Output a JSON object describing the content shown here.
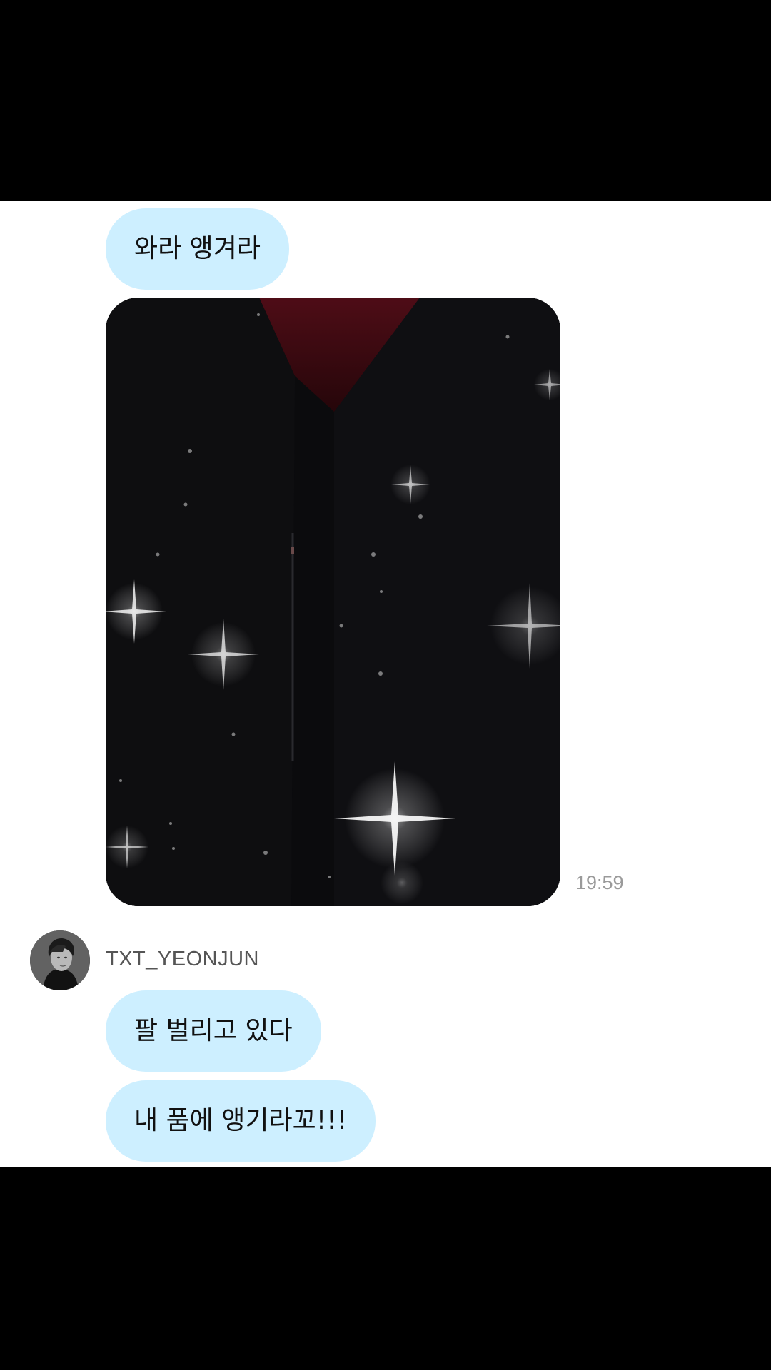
{
  "messages": [
    {
      "text": "와라 앵겨라"
    }
  ],
  "media_message": {
    "timestamp": "19:59"
  },
  "incoming": {
    "sender_name": "TXT_YEONJUN",
    "messages": [
      {
        "text": "팔 벌리고 있다"
      },
      {
        "text": "내 품에 앵기라꼬!!!"
      }
    ]
  },
  "colors": {
    "bubble": "#cdefff",
    "chat_background": "#ffffff",
    "letterbox": "#000000"
  }
}
